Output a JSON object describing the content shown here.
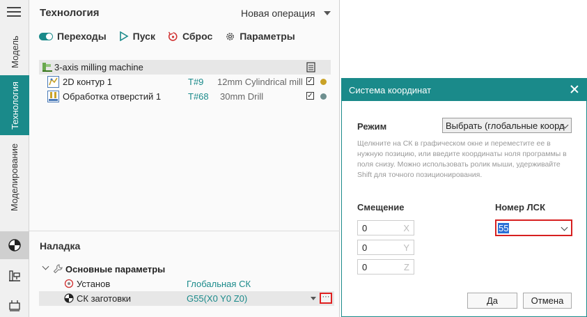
{
  "sidebar": {
    "tabs": [
      {
        "label": "Модель",
        "active": false
      },
      {
        "label": "Технология",
        "active": true
      },
      {
        "label": "Моделирование",
        "active": false
      }
    ],
    "tools": [
      "simulation-icon",
      "machine-icon",
      "setup-icon"
    ]
  },
  "header": {
    "title": "Технология",
    "new_operation": "Новая операция"
  },
  "toolbar": {
    "transitions": "Переходы",
    "start": "Пуск",
    "reset": "Сброс",
    "parameters": "Параметры"
  },
  "tree": {
    "machine": "3-axis milling machine",
    "operations": [
      {
        "name": "2D контур 1",
        "tool": "T#9",
        "desc": "12mm Cylindrical mill",
        "checked": true,
        "dot_color": "#c9a227"
      },
      {
        "name": "Обработка отверстий 1",
        "tool": "T#68",
        "desc": "30mm Drill",
        "checked": true,
        "dot_color": "#6e8f8f"
      }
    ]
  },
  "setup": {
    "title": "Наладка",
    "group": "Основные параметры",
    "rows": [
      {
        "label": "Установ",
        "value": "Глобальная СК"
      },
      {
        "label": "СК заготовки",
        "value": "G55(X0 Y0 Z0)"
      }
    ],
    "more": "···"
  },
  "dialog": {
    "title": "Система координат",
    "mode_label": "Режим",
    "mode_value": "Выбрать (глобальные коорд",
    "hint": "Щелкните на СК в графическом окне и переместите ее в нужную позицию, или введите координаты ноля программы в поля снизу. Можно использовать ролик мыши, удерживайте Shift для точного позиционирования.",
    "offset_label": "Смещение",
    "lsk_label": "Номер ЛСК",
    "lsk_value": "55",
    "coords": [
      {
        "axis": "X",
        "value": "0"
      },
      {
        "axis": "Y",
        "value": "0"
      },
      {
        "axis": "Z",
        "value": "0"
      }
    ],
    "ok": "Да",
    "cancel": "Отмена"
  },
  "colors": {
    "accent": "#1a8a8a",
    "highlight_border": "#d72020"
  }
}
